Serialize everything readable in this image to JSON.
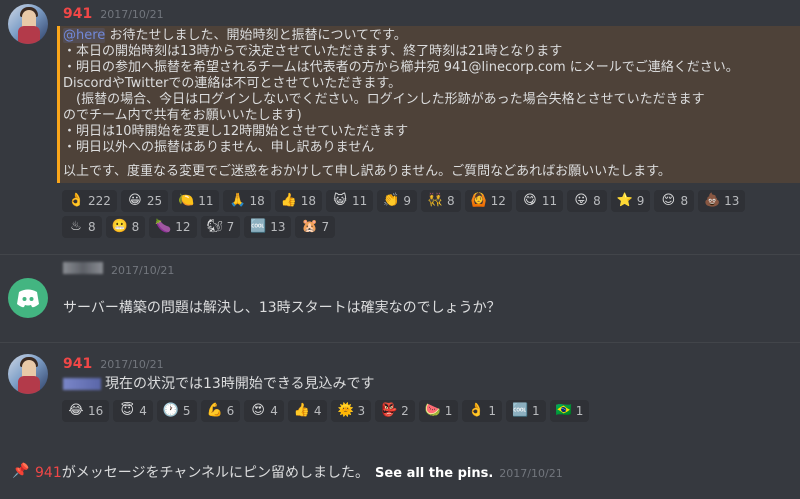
{
  "messages": [
    {
      "username": "941",
      "timestamp": "2017/10/21",
      "mention": "@here",
      "lines": [
        "お待たせしました、開始時刻と振替についてです。",
        "・本日の開始時刻は13時からで決定させていただきます、終了時刻は21時となります",
        "・明日の参加へ振替を希望されるチームは代表者の方から櫛井宛 941@linecorp.com にメールでご連絡ください。",
        "DiscordやTwitterでの連絡は不可とさせていただきます。",
        "　(振替の場合、今日はログインしないでください。ログインした形跡があった場合失格とさせていただきます",
        "のでチーム内で共有をお願いいたします)",
        "・明日は10時開始を変更し12時開始とさせていただきます",
        "・明日以外への振替はありません、申し訳ありません",
        "",
        "以上です、度重なる変更でご迷惑をおかけして申し訳ありません。ご質問などあればお願いいたします。"
      ],
      "reactions_row1": [
        {
          "emoji": "👌",
          "count": "222"
        },
        {
          "emoji": "😀",
          "count": "25"
        },
        {
          "emoji": "🍋",
          "count": "11"
        },
        {
          "emoji": "🙏",
          "count": "18"
        },
        {
          "emoji": "👍",
          "count": "18"
        },
        {
          "emoji": "😺",
          "count": "11"
        },
        {
          "emoji": "👏",
          "count": "9"
        },
        {
          "emoji": "👯",
          "count": "8"
        },
        {
          "emoji": "🙆",
          "count": "12"
        },
        {
          "emoji": "😋",
          "count": "11"
        },
        {
          "emoji": "😛",
          "count": "8"
        },
        {
          "emoji": "⭐",
          "count": "9"
        },
        {
          "emoji": "😌",
          "count": "8"
        },
        {
          "emoji": "💩",
          "count": "13"
        }
      ],
      "reactions_row2": [
        {
          "emoji": "♨",
          "count": "8"
        },
        {
          "emoji": "😬",
          "count": "8"
        },
        {
          "emoji": "🍆",
          "count": "12"
        },
        {
          "emoji": "🐿",
          "count": "7"
        },
        {
          "emoji": "🆒",
          "count": "13"
        },
        {
          "emoji": "🐹",
          "count": "7"
        }
      ]
    },
    {
      "timestamp": "2017/10/21",
      "text": "サーバー構築の問題は解決し、13時スタートは確実なのでしょうか？"
    },
    {
      "username": "941",
      "timestamp": "2017/10/21",
      "text": "現在の状況では13時開始できる見込みです",
      "reactions": [
        {
          "emoji": "😂",
          "count": "16"
        },
        {
          "emoji": "😇",
          "count": "4"
        },
        {
          "emoji": "🕐",
          "count": "5"
        },
        {
          "emoji": "💪",
          "count": "6"
        },
        {
          "emoji": "😍",
          "count": "4"
        },
        {
          "emoji": "👍",
          "count": "4"
        },
        {
          "emoji": "🌞",
          "count": "3"
        },
        {
          "emoji": "👺",
          "count": "2"
        },
        {
          "emoji": "🍉",
          "count": "1"
        },
        {
          "emoji": "👌",
          "count": "1"
        },
        {
          "emoji": "🆒",
          "count": "1"
        },
        {
          "emoji": "🇧🇷",
          "count": "1"
        }
      ]
    }
  ],
  "pin": {
    "username": "941",
    "text": "がメッセージをチャンネルにピン留めしました。",
    "link": "See all the pins.",
    "timestamp": "2017/10/21"
  },
  "colors": {
    "background": "#36393f",
    "username": "#f04747",
    "highlight_bg": "#4e4239",
    "highlight_border": "#faa61a",
    "mention": "#7289da",
    "reaction_bg": "#2f3136"
  }
}
